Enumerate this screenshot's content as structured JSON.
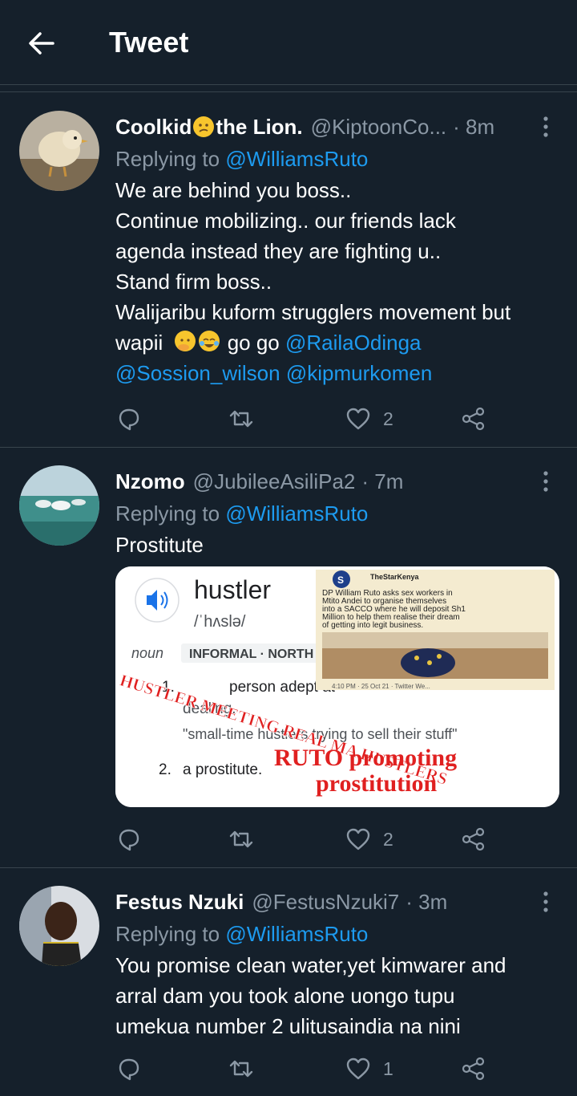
{
  "header": {
    "title": "Tweet"
  },
  "tweets": [
    {
      "name": "Coolkid",
      "name_suffix": " the Lion.",
      "handle": "@KiptoonCo...",
      "time": "· 8m",
      "replying_prefix": "Replying to ",
      "replying_to": "@WilliamsRuto",
      "body_lines": [
        "We are behind you boss..",
        "Continue mobilizing.. our friends lack",
        "agenda instead they are fighting u..",
        "Stand firm boss..",
        "Walijaribu kuform strugglers movement but"
      ],
      "body_last_prefix": "wapii",
      "body_last_text": " go go ",
      "mention_1": "@RailaOdinga",
      "mention_2": "@Sossion_wilson",
      "mention_3": "@kipmurkomen",
      "reply_count": "",
      "retweet_count": "",
      "like_count": "2"
    },
    {
      "name": "Nzomo",
      "handle": "@JubileeAsiliPa2",
      "time": "· 7m",
      "replying_prefix": "Replying to ",
      "replying_to": "@WilliamsRuto",
      "body": "Prostitute",
      "media": {
        "word": "hustler",
        "phonetic": "/ˈhʌslə/",
        "pos": "noun",
        "register": "INFORMAL · NORTH",
        "def1_a": "person adept at",
        "def1_b": "dealing.",
        "example": "\"small-time hustlers trying to sell their stuff\"",
        "def2_num": "2.",
        "def2": "a prostitute.",
        "overlay_red": "HUSTLER MEETING REAL MA HUSTLERS",
        "overlay_big1": "RUTO promoting",
        "overlay_big2": "prostitution",
        "news_source": "TheStarKenya",
        "news_text_1": "DP William Ruto asks sex workers in",
        "news_text_2": "Mtito Andei to organise themselves",
        "news_text_3": "into a SACCO where he will deposit Sh1",
        "news_text_4": "Million to help them realise their dream",
        "news_text_5": "of getting into legit business.",
        "news_time": "4:10 PM · 25 Oct 21 · Twitter We..."
      },
      "like_count": "2"
    },
    {
      "name": "Festus Nzuki",
      "handle": "@FestusNzuki7",
      "time": "· 3m",
      "replying_prefix": "Replying to ",
      "replying_to": "@WilliamsRuto",
      "body_lines": [
        "You promise clean water,yet kimwarer and",
        "arral dam you took alone uongo tupu",
        "umekua number 2 ulitusaindia na nini"
      ],
      "like_count": "1"
    }
  ],
  "colors": {
    "bg": "#15202b",
    "muted": "#8b98a5",
    "link": "#1d9bf0",
    "border": "#38444d"
  }
}
